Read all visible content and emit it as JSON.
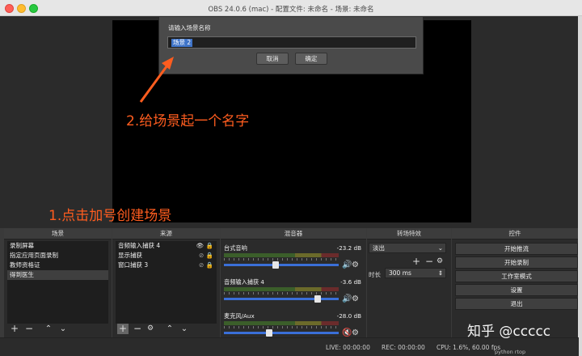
{
  "window": {
    "title": "OBS 24.0.6 (mac) - 配置文件: 未命名 - 场景: 未命名"
  },
  "dialog": {
    "label": "请输入场景名称",
    "input_value": "场景 2",
    "cancel": "取消",
    "ok": "确定"
  },
  "annotations": {
    "step2": "2.给场景起一个名字",
    "step1": "1.点击加号创建场景"
  },
  "docks": {
    "scenes": {
      "title": "场景",
      "items": [
        "录制屏幕",
        "指定应用页面录制",
        "教师资格证",
        "得到医生"
      ],
      "selected_index": 3
    },
    "sources": {
      "title": "来源",
      "items": [
        "音频输入捕获 4",
        "显示捕获",
        "窗口捕获 3"
      ]
    },
    "mixer": {
      "title": "混音器",
      "channels": [
        {
          "name": "台式音响",
          "db": "-23.2 dB",
          "level": 0.45
        },
        {
          "name": "音频输入捕获 4",
          "db": "-3.6 dB",
          "level": 0.82
        },
        {
          "name": "麦克风/Aux",
          "db": "-28.0 dB",
          "level": 0.4,
          "muted": true
        }
      ]
    },
    "transitions": {
      "title": "转场特效",
      "selected": "淡出",
      "duration_label": "时长",
      "duration_value": "300 ms"
    },
    "controls": {
      "title": "控件",
      "buttons": [
        "开始推流",
        "开始录制",
        "工作室模式",
        "设置",
        "退出"
      ]
    }
  },
  "status": {
    "live": "LIVE: 00:00:00",
    "rec": "REC: 00:00:00",
    "cpu": "CPU: 1.6%, 60.00 fps"
  },
  "watermark": "知乎 @ccccc",
  "bottom_right_text": "python rtop"
}
